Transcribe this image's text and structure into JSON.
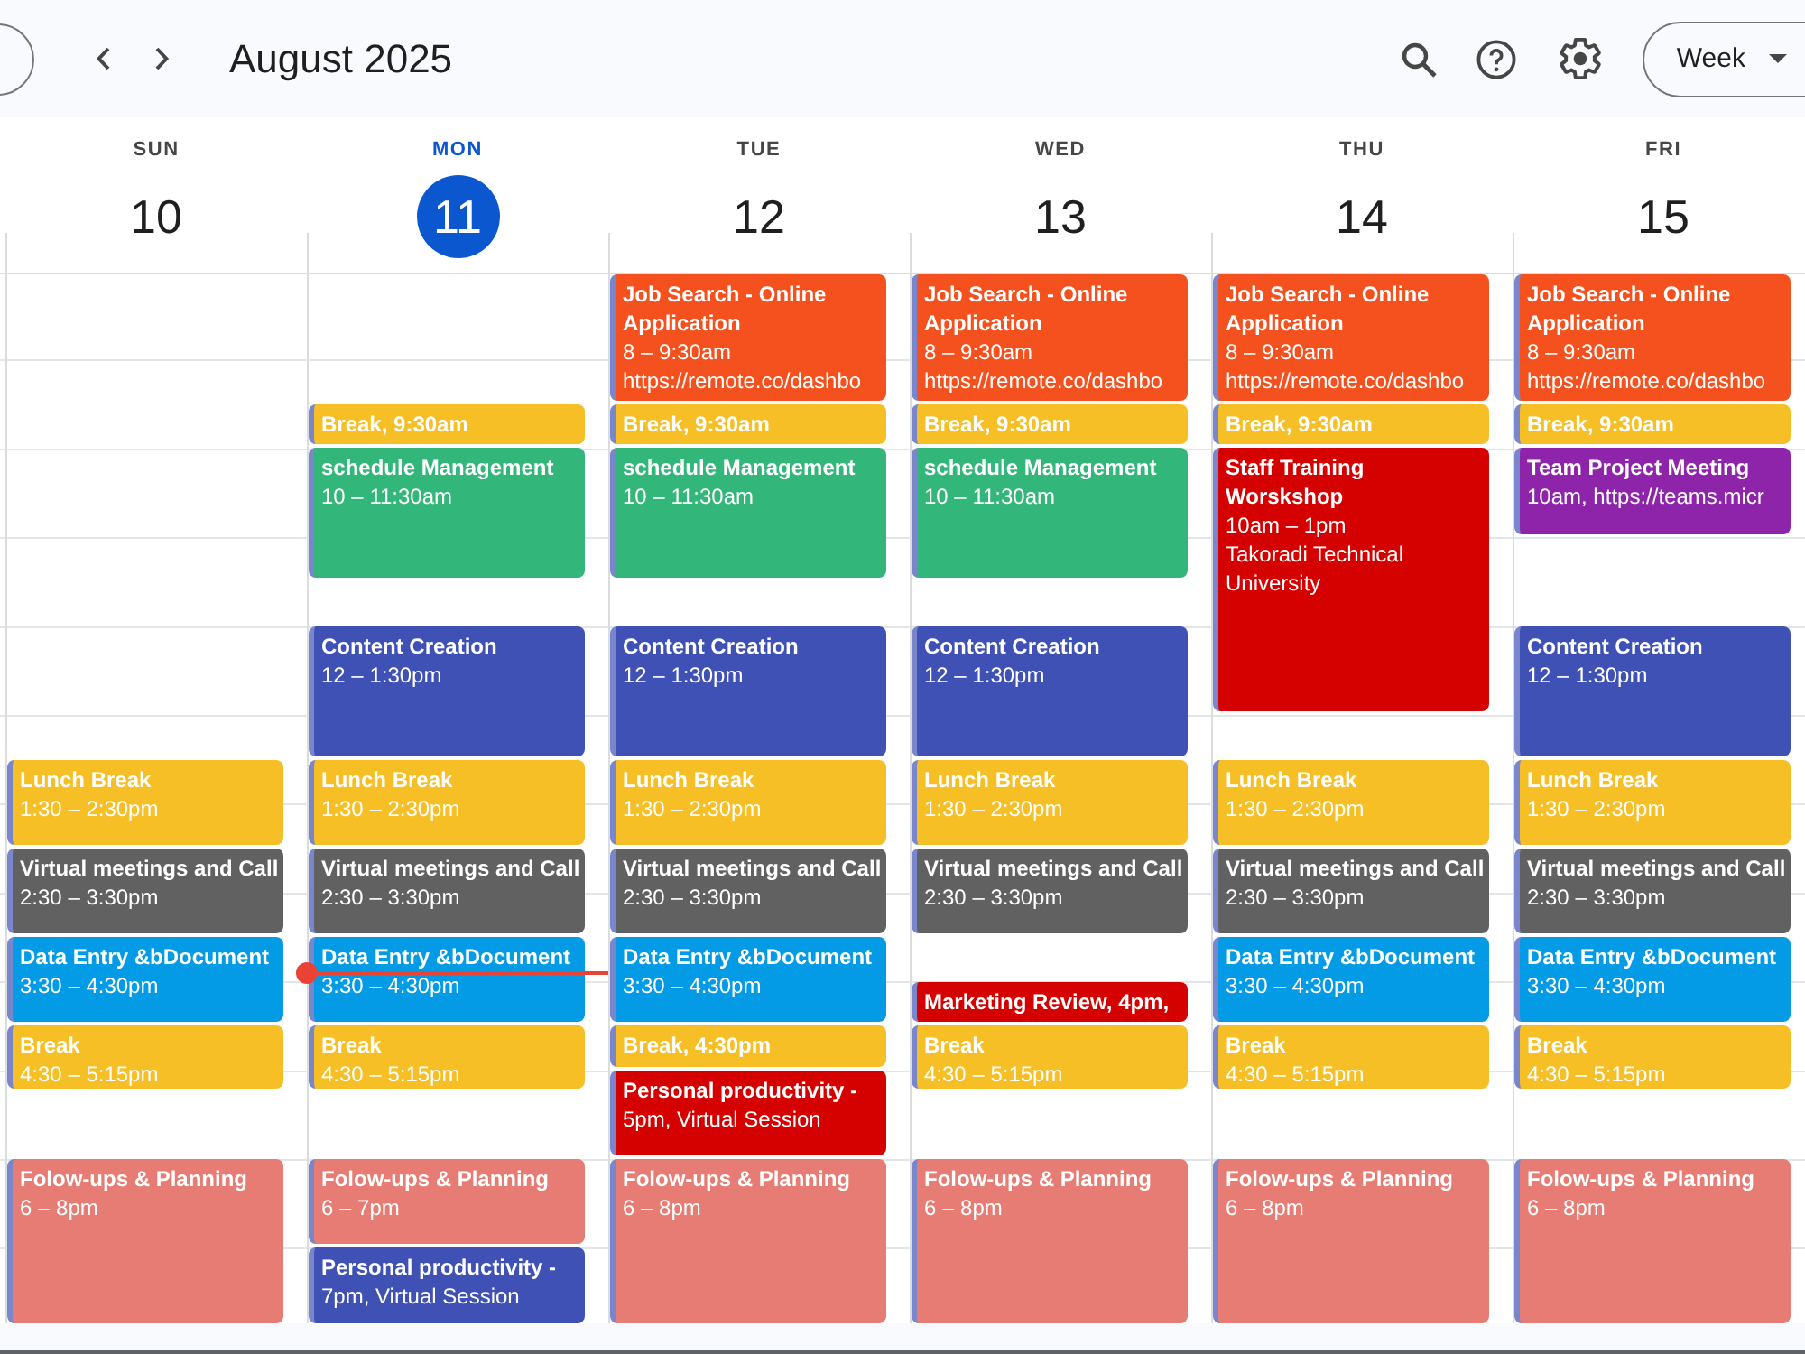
{
  "toolbar": {
    "title": "August 2025",
    "view": "Week"
  },
  "days": [
    {
      "weekday": "SUN",
      "date": "10",
      "today": false,
      "events": [
        {
          "title": "Lunch Break",
          "details": [
            "1:30 – 2:30pm"
          ],
          "color": "#f6bf26"
        },
        {
          "title": "Virtual meetings and Call",
          "details": [
            "2:30 – 3:30pm"
          ],
          "color": "#616161"
        },
        {
          "title": "Data Entry &bDocument",
          "details": [
            "3:30 – 4:30pm"
          ],
          "color": "#039be5"
        },
        {
          "title": "Break",
          "details": [
            "4:30 – 5:15pm"
          ],
          "color": "#f6bf26"
        },
        {
          "title": "Folow-ups & Planning",
          "details": [
            "6 – 8pm"
          ],
          "color": "#e67c73"
        }
      ]
    },
    {
      "weekday": "MON",
      "date": "11",
      "today": true,
      "events": [
        {
          "title": "Break, 9:30am",
          "color": "#f6bf26"
        },
        {
          "title": "schedule Management",
          "details": [
            "10 – 11:30am"
          ],
          "color": "#33b679"
        },
        {
          "title": "Content Creation",
          "details": [
            "12 – 1:30pm"
          ],
          "color": "#3f51b5"
        },
        {
          "title": "Lunch Break",
          "details": [
            "1:30 – 2:30pm"
          ],
          "color": "#f6bf26"
        },
        {
          "title": "Virtual meetings and Call",
          "details": [
            "2:30 – 3:30pm"
          ],
          "color": "#616161"
        },
        {
          "title": "Data Entry &bDocument",
          "details": [
            "3:30 – 4:30pm"
          ],
          "color": "#039be5"
        },
        {
          "title": "Break",
          "details": [
            "4:30 – 5:15pm"
          ],
          "color": "#f6bf26"
        },
        {
          "title": "Folow-ups & Planning",
          "details": [
            "6 – 7pm"
          ],
          "color": "#e67c73"
        },
        {
          "title": "Personal productivity -",
          "details": [
            "7pm, Virtual Session"
          ],
          "color": "#3f51b5"
        }
      ]
    },
    {
      "weekday": "TUE",
      "date": "12",
      "today": false,
      "events": [
        {
          "title": "Job Search - Online Application",
          "details": [
            "8 – 9:30am",
            "https://remote.co/dashbo"
          ],
          "color": "#f4511e"
        },
        {
          "title": "Break, 9:30am",
          "color": "#f6bf26"
        },
        {
          "title": "schedule Management",
          "details": [
            "10 – 11:30am"
          ],
          "color": "#33b679"
        },
        {
          "title": "Content Creation",
          "details": [
            "12 – 1:30pm"
          ],
          "color": "#3f51b5"
        },
        {
          "title": "Lunch Break",
          "details": [
            "1:30 – 2:30pm"
          ],
          "color": "#f6bf26"
        },
        {
          "title": "Virtual meetings and Call",
          "details": [
            "2:30 – 3:30pm"
          ],
          "color": "#616161"
        },
        {
          "title": "Data Entry &bDocument",
          "details": [
            "3:30 – 4:30pm"
          ],
          "color": "#039be5"
        },
        {
          "title": "Break, 4:30pm",
          "color": "#f6bf26"
        },
        {
          "title": "Personal productivity -",
          "details": [
            "5pm, Virtual Session"
          ],
          "color": "#d50000"
        },
        {
          "title": "Folow-ups & Planning",
          "details": [
            "6 – 8pm"
          ],
          "color": "#e67c73"
        }
      ]
    },
    {
      "weekday": "WED",
      "date": "13",
      "today": false,
      "events": [
        {
          "title": "Job Search - Online Application",
          "details": [
            "8 – 9:30am",
            "https://remote.co/dashbo"
          ],
          "color": "#f4511e"
        },
        {
          "title": "Break, 9:30am",
          "color": "#f6bf26"
        },
        {
          "title": "schedule Management",
          "details": [
            "10 – 11:30am"
          ],
          "color": "#33b679"
        },
        {
          "title": "Content Creation",
          "details": [
            "12 – 1:30pm"
          ],
          "color": "#3f51b5"
        },
        {
          "title": "Lunch Break",
          "details": [
            "1:30 – 2:30pm"
          ],
          "color": "#f6bf26"
        },
        {
          "title": "Virtual meetings and Call",
          "details": [
            "2:30 – 3:30pm"
          ],
          "color": "#616161"
        },
        {
          "title": "Marketing Review, 4pm,",
          "color": "#d50000"
        },
        {
          "title": "Break",
          "details": [
            "4:30 – 5:15pm"
          ],
          "color": "#f6bf26"
        },
        {
          "title": "Folow-ups & Planning",
          "details": [
            "6 – 8pm"
          ],
          "color": "#e67c73"
        }
      ]
    },
    {
      "weekday": "THU",
      "date": "14",
      "today": false,
      "events": [
        {
          "title": "Job Search - Online Application",
          "details": [
            "8 – 9:30am",
            "https://remote.co/dashbo"
          ],
          "color": "#f4511e"
        },
        {
          "title": "Break, 9:30am",
          "color": "#f6bf26"
        },
        {
          "title": "Staff Training Worskshop",
          "details": [
            "10am – 1pm",
            "Takoradi Technical University"
          ],
          "color": "#d50000"
        },
        {
          "title": "Lunch Break",
          "details": [
            "1:30 – 2:30pm"
          ],
          "color": "#f6bf26"
        },
        {
          "title": "Virtual meetings and Call",
          "details": [
            "2:30 – 3:30pm"
          ],
          "color": "#616161"
        },
        {
          "title": "Data Entry &bDocument",
          "details": [
            "3:30 – 4:30pm"
          ],
          "color": "#039be5"
        },
        {
          "title": "Break",
          "details": [
            "4:30 – 5:15pm"
          ],
          "color": "#f6bf26"
        },
        {
          "title": "Folow-ups & Planning",
          "details": [
            "6 – 8pm"
          ],
          "color": "#e67c73"
        }
      ]
    },
    {
      "weekday": "FRI",
      "date": "15",
      "today": false,
      "events": [
        {
          "title": "Job Search - Online Application",
          "details": [
            "8 – 9:30am",
            "https://remote.co/dashbo"
          ],
          "color": "#f4511e"
        },
        {
          "title": "Break, 9:30am",
          "color": "#f6bf26"
        },
        {
          "title": "Team Project Meeting",
          "details": [
            "10am, https://teams.micr"
          ],
          "color": "#8e24aa"
        },
        {
          "title": "Content Creation",
          "details": [
            "12 – 1:30pm"
          ],
          "color": "#3f51b5"
        },
        {
          "title": "Lunch Break",
          "details": [
            "1:30 – 2:30pm"
          ],
          "color": "#f6bf26"
        },
        {
          "title": "Virtual meetings and Call",
          "details": [
            "2:30 – 3:30pm"
          ],
          "color": "#616161"
        },
        {
          "title": "Data Entry &bDocument",
          "details": [
            "3:30 – 4:30pm"
          ],
          "color": "#039be5"
        },
        {
          "title": "Break",
          "details": [
            "4:30 – 5:15pm"
          ],
          "color": "#f6bf26"
        },
        {
          "title": "Folow-ups & Planning",
          "details": [
            "6 – 8pm"
          ],
          "color": "#e67c73"
        }
      ]
    }
  ]
}
